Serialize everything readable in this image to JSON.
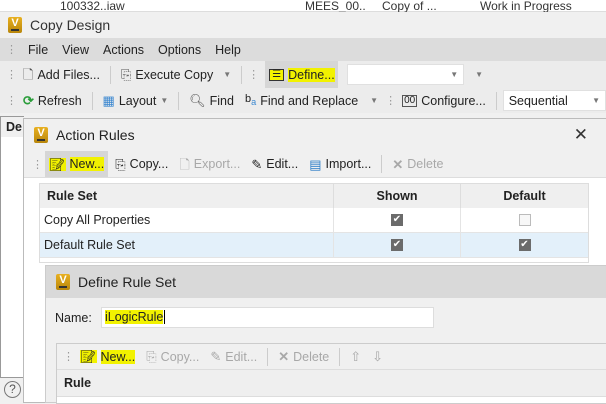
{
  "background_row": {
    "cells": [
      "100332..iaw",
      "MEES_00..",
      "Copy of ...",
      "Work in Progress"
    ]
  },
  "window": {
    "title": "Copy Design"
  },
  "menu": [
    "File",
    "View",
    "Actions",
    "Options",
    "Help"
  ],
  "toolbar1": {
    "add_files": "Add Files...",
    "execute_copy": "Execute Copy",
    "define": "Define...",
    "combo_value": ""
  },
  "toolbar2": {
    "refresh": "Refresh",
    "layout": "Layout",
    "find": "Find",
    "find_replace": "Find and Replace",
    "configure": "Configure...",
    "numbering": "Sequential"
  },
  "left_panel": {
    "header": "De"
  },
  "action_rules": {
    "title": "Action Rules",
    "toolbar": {
      "new": "New...",
      "copy": "Copy...",
      "export": "Export...",
      "edit": "Edit...",
      "import": "Import...",
      "delete": "Delete"
    },
    "columns": [
      "Rule Set",
      "Shown",
      "Default"
    ],
    "rows": [
      {
        "name": "Copy All Properties",
        "shown": true,
        "default": false
      },
      {
        "name": "Default Rule Set",
        "shown": true,
        "default": true
      }
    ]
  },
  "define_rule_set": {
    "title": "Define Rule Set",
    "name_label": "Name:",
    "name_value": "iLogicRule",
    "toolbar": {
      "new": "New...",
      "copy": "Copy...",
      "edit": "Edit...",
      "delete": "Delete"
    },
    "columns": [
      "Rule"
    ]
  },
  "colors": {
    "highlight": "#f2f200",
    "selected_row": "#e3f0fa"
  }
}
